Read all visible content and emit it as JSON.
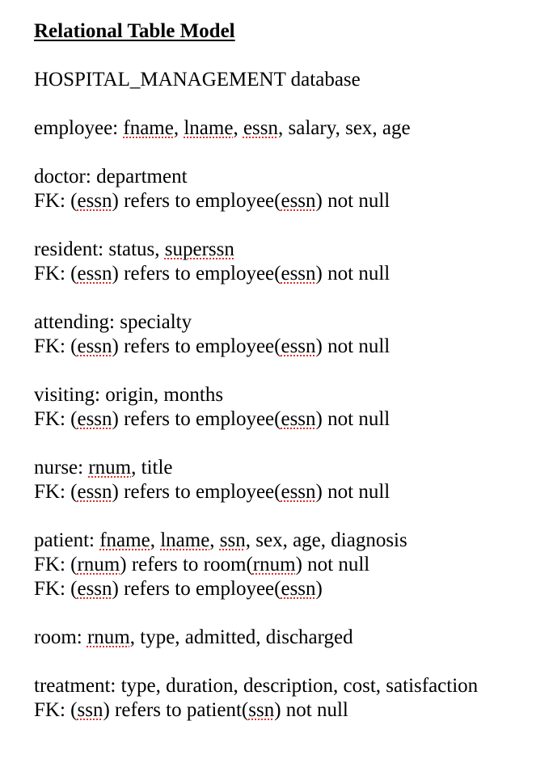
{
  "title": "Relational Table Model",
  "lines": [
    [
      {
        "t": "HOSPITAL_MANAGEMENT database"
      }
    ],
    [
      {
        "t": "employee: "
      },
      {
        "t": "fname",
        "s": true
      },
      {
        "t": ", "
      },
      {
        "t": "lname",
        "s": true
      },
      {
        "t": ", "
      },
      {
        "t": "essn",
        "s": true
      },
      {
        "t": ", salary, sex, age"
      }
    ],
    [
      {
        "t": "doctor: department"
      }
    ],
    [
      {
        "t": "FK: ("
      },
      {
        "t": "essn",
        "s": true
      },
      {
        "t": ") refers to employee("
      },
      {
        "t": "essn",
        "s": true
      },
      {
        "t": ") not null"
      }
    ],
    [
      {
        "t": "resident: status, "
      },
      {
        "t": "superssn",
        "s": true
      }
    ],
    [
      {
        "t": "FK: ("
      },
      {
        "t": "essn",
        "s": true
      },
      {
        "t": ") refers to employee("
      },
      {
        "t": "essn",
        "s": true
      },
      {
        "t": ") not null"
      }
    ],
    [
      {
        "t": "attending: specialty"
      }
    ],
    [
      {
        "t": "FK: ("
      },
      {
        "t": "essn",
        "s": true
      },
      {
        "t": ") refers to employee("
      },
      {
        "t": "essn",
        "s": true
      },
      {
        "t": ") not null"
      }
    ],
    [
      {
        "t": "visiting: origin, months"
      }
    ],
    [
      {
        "t": "FK: ("
      },
      {
        "t": "essn",
        "s": true
      },
      {
        "t": ") refers to employee("
      },
      {
        "t": "essn",
        "s": true
      },
      {
        "t": ") not null"
      }
    ],
    [
      {
        "t": "nurse: "
      },
      {
        "t": "rnum",
        "s": true
      },
      {
        "t": ", title"
      }
    ],
    [
      {
        "t": "FK: ("
      },
      {
        "t": "essn",
        "s": true
      },
      {
        "t": ") refers to employee("
      },
      {
        "t": "essn",
        "s": true
      },
      {
        "t": ") not null"
      }
    ],
    [
      {
        "t": "patient: "
      },
      {
        "t": "fname",
        "s": true
      },
      {
        "t": ", "
      },
      {
        "t": "lname",
        "s": true
      },
      {
        "t": ", "
      },
      {
        "t": "ssn",
        "s": true
      },
      {
        "t": ", sex, age, diagnosis"
      }
    ],
    [
      {
        "t": "FK: ("
      },
      {
        "t": "rnum",
        "s": true
      },
      {
        "t": ") refers to room("
      },
      {
        "t": "rnum",
        "s": true
      },
      {
        "t": ") not null"
      }
    ],
    [
      {
        "t": "FK: ("
      },
      {
        "t": "essn",
        "s": true
      },
      {
        "t": ") refers to employee("
      },
      {
        "t": "essn",
        "s": true
      },
      {
        "t": ")"
      }
    ],
    [
      {
        "t": "room: "
      },
      {
        "t": "rnum",
        "s": true
      },
      {
        "t": ", type, admitted, discharged"
      }
    ],
    [
      {
        "t": "treatment: type, duration, description, cost, satisfaction"
      }
    ],
    [
      {
        "t": "FK: ("
      },
      {
        "t": "ssn",
        "s": true
      },
      {
        "t": ") refers to patient("
      },
      {
        "t": "ssn",
        "s": true
      },
      {
        "t": ") not null"
      }
    ]
  ]
}
